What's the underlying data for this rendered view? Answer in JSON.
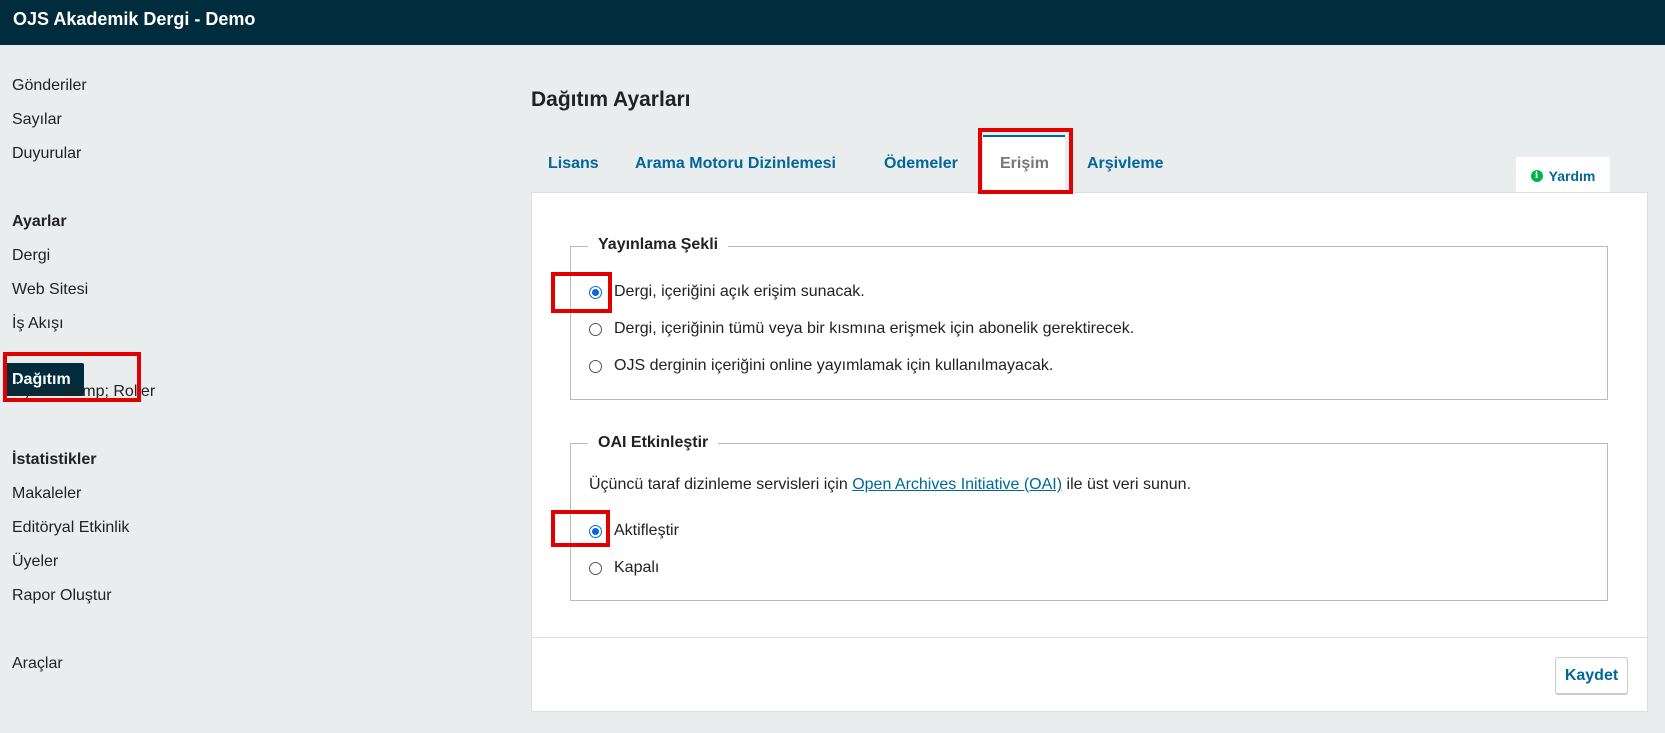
{
  "app": {
    "title": "OJS Akademik Dergi - Demo"
  },
  "nav": {
    "submissions": "Gönderiler",
    "issues": "Sayılar",
    "announcements": "Duyurular",
    "settings_heading": "Ayarlar",
    "journal": "Dergi",
    "website": "Web Sitesi",
    "workflow": "İş Akışı",
    "distribution": "Dağıtım",
    "users_roles": "Üyeler &amp; Roller",
    "statistics_heading": "İstatistikler",
    "articles": "Makaleler",
    "editorial_activity": "Editöryal Etkinlik",
    "users": "Üyeler",
    "report": "Rapor Oluştur",
    "tools": "Araçlar"
  },
  "page": {
    "title": "Dağıtım Ayarları"
  },
  "tabs": {
    "license": "Lisans",
    "search_indexing": "Arama Motoru Dizinlemesi",
    "payments": "Ödemeler",
    "access": "Erişim",
    "archiving": "Arşivleme"
  },
  "help": {
    "label": "Yardım"
  },
  "publishing_mode": {
    "legend": "Yayınlama Şekli",
    "options": [
      "Dergi, içeriğini açık erişim sunacak.",
      "Dergi, içeriğinin tümü veya bir kısmına erişmek için abonelik gerektirecek.",
      "OJS derginin içeriğini online yayımlamak için kullanılmayacak."
    ],
    "selected_index": 0
  },
  "oai": {
    "legend": "OAI Etkinleştir",
    "desc_before": "Üçüncü taraf dizinleme servisleri için ",
    "desc_link": "Open Archives Initiative (OAI)",
    "desc_after": " ile üst veri sunun.",
    "options": [
      "Aktifleştir",
      "Kapalı"
    ],
    "selected_index": 0
  },
  "actions": {
    "save": "Kaydet"
  },
  "colors": {
    "header_bg": "#002c3e",
    "link": "#006798",
    "highlight": "#e00000",
    "radio_checked": "#0a66d8"
  }
}
